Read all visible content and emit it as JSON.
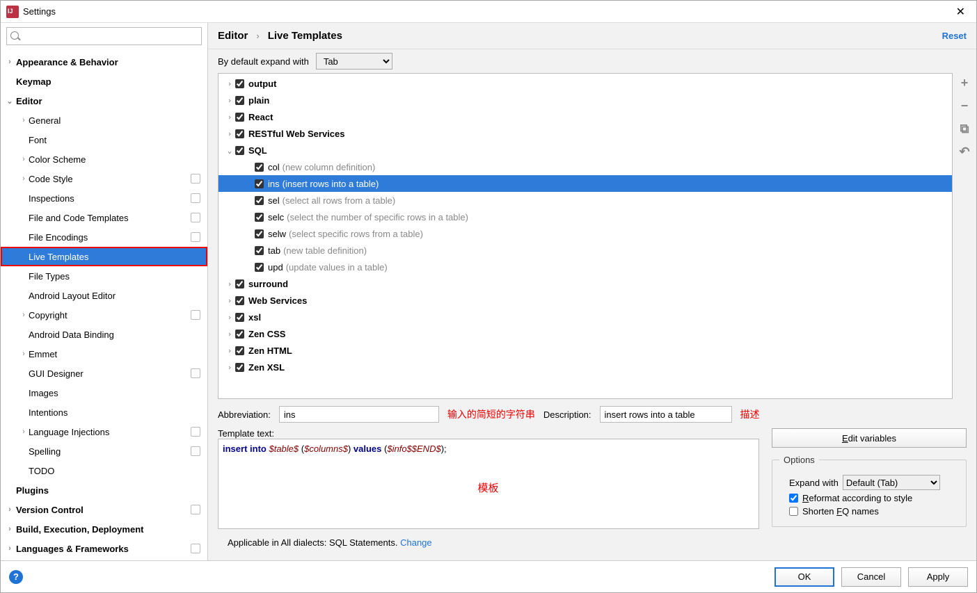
{
  "window": {
    "title": "Settings",
    "close_glyph": "✕"
  },
  "sidebar": {
    "search_placeholder": "",
    "items": [
      {
        "label": "Appearance & Behavior",
        "level": 0,
        "chev": "›",
        "bold": true
      },
      {
        "label": "Keymap",
        "level": 0,
        "bold": true
      },
      {
        "label": "Editor",
        "level": 0,
        "chev": "⌄",
        "bold": true
      },
      {
        "label": "General",
        "level": 1,
        "chev": "›"
      },
      {
        "label": "Font",
        "level": 1
      },
      {
        "label": "Color Scheme",
        "level": 1,
        "chev": "›"
      },
      {
        "label": "Code Style",
        "level": 1,
        "chev": "›",
        "badge": true
      },
      {
        "label": "Inspections",
        "level": 1,
        "badge": true
      },
      {
        "label": "File and Code Templates",
        "level": 1,
        "badge": true
      },
      {
        "label": "File Encodings",
        "level": 1,
        "badge": true
      },
      {
        "label": "Live Templates",
        "level": 1,
        "selected": true,
        "outlined": true
      },
      {
        "label": "File Types",
        "level": 1
      },
      {
        "label": "Android Layout Editor",
        "level": 1
      },
      {
        "label": "Copyright",
        "level": 1,
        "chev": "›",
        "badge": true
      },
      {
        "label": "Android Data Binding",
        "level": 1
      },
      {
        "label": "Emmet",
        "level": 1,
        "chev": "›"
      },
      {
        "label": "GUI Designer",
        "level": 1,
        "badge": true
      },
      {
        "label": "Images",
        "level": 1
      },
      {
        "label": "Intentions",
        "level": 1
      },
      {
        "label": "Language Injections",
        "level": 1,
        "chev": "›",
        "badge": true
      },
      {
        "label": "Spelling",
        "level": 1,
        "badge": true
      },
      {
        "label": "TODO",
        "level": 1
      },
      {
        "label": "Plugins",
        "level": 0,
        "bold": true
      },
      {
        "label": "Version Control",
        "level": 0,
        "chev": "›",
        "bold": true,
        "badge": true
      },
      {
        "label": "Build, Execution, Deployment",
        "level": 0,
        "chev": "›",
        "bold": true
      },
      {
        "label": "Languages & Frameworks",
        "level": 0,
        "chev": "›",
        "bold": true,
        "badge": true
      }
    ]
  },
  "crumbs": {
    "a": "Editor",
    "b": "Live Templates",
    "reset": "Reset"
  },
  "default_expand": {
    "label": "By default expand with",
    "value": "Tab"
  },
  "toolbar": {
    "add": "+",
    "remove": "−",
    "copy_glyph": "⧉",
    "undo_glyph": "↶"
  },
  "template_groups": [
    {
      "type": "group",
      "name": "output",
      "open": false
    },
    {
      "type": "group",
      "name": "plain",
      "open": false
    },
    {
      "type": "group",
      "name": "React",
      "open": false
    },
    {
      "type": "group",
      "name": "RESTful Web Services",
      "open": false
    },
    {
      "type": "group",
      "name": "SQL",
      "open": true
    },
    {
      "type": "leaf",
      "name": "col",
      "desc": "(new column definition)"
    },
    {
      "type": "leaf",
      "name": "ins",
      "desc": "(insert rows into a table)",
      "selected": true
    },
    {
      "type": "leaf",
      "name": "sel",
      "desc": "(select all rows from a table)"
    },
    {
      "type": "leaf",
      "name": "selc",
      "desc": "(select the number of specific rows in a table)"
    },
    {
      "type": "leaf",
      "name": "selw",
      "desc": "(select specific rows from a table)"
    },
    {
      "type": "leaf",
      "name": "tab",
      "desc": "(new table definition)"
    },
    {
      "type": "leaf",
      "name": "upd",
      "desc": "(update values in a table)"
    },
    {
      "type": "group",
      "name": "surround",
      "open": false
    },
    {
      "type": "group",
      "name": "Web Services",
      "open": false
    },
    {
      "type": "group",
      "name": "xsl",
      "open": false
    },
    {
      "type": "group",
      "name": "Zen CSS",
      "open": false
    },
    {
      "type": "group",
      "name": "Zen HTML",
      "open": false
    },
    {
      "type": "group",
      "name": "Zen XSL",
      "open": false
    }
  ],
  "details": {
    "abbr_label": "Abbreviation:",
    "abbr_value": "ins",
    "abbr_anno": "输入的简短的字符串",
    "desc_label": "Description:",
    "desc_value": "insert rows into a table",
    "desc_anno": "描述",
    "template_label": "Template text:",
    "template_tokens": [
      {
        "t": "insert",
        "c": "kw"
      },
      {
        "t": " "
      },
      {
        "t": "into",
        "c": "kw"
      },
      {
        "t": " "
      },
      {
        "t": "$table$",
        "c": "var"
      },
      {
        "t": " ("
      },
      {
        "t": "$columns$",
        "c": "var"
      },
      {
        "t": ") "
      },
      {
        "t": "values",
        "c": "kw"
      },
      {
        "t": " ("
      },
      {
        "t": "$info$",
        "c": "var"
      },
      {
        "t": "$END$",
        "c": "var"
      },
      {
        "t": ");"
      }
    ],
    "template_anno": "模板",
    "edit_vars": "Edit variables",
    "options_legend": "Options",
    "expand_with_label": "Expand with",
    "expand_with_value": "Default (Tab)",
    "reformat_label": "Reformat according to style",
    "reformat_checked": true,
    "shorten_label": "Shorten FQ names",
    "shorten_checked": false,
    "applicable_prefix": "Applicable in All dialects: SQL Statements. ",
    "applicable_change": "Change"
  },
  "footer": {
    "help": "?",
    "ok": "OK",
    "cancel": "Cancel",
    "apply": "Apply"
  }
}
